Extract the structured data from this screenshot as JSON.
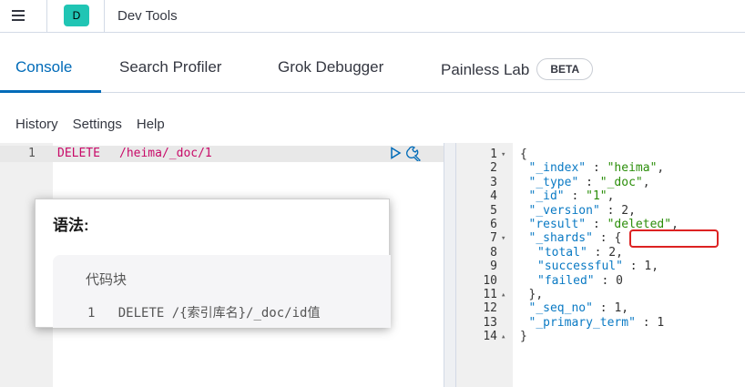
{
  "header": {
    "space_initial": "D",
    "app_title": "Dev Tools",
    "space_color": "#20c5b4"
  },
  "tabs": [
    {
      "label": "Console",
      "active": true
    },
    {
      "label": "Search Profiler",
      "active": false
    },
    {
      "label": "Grok Debugger",
      "active": false
    },
    {
      "label": "Painless Lab",
      "active": false,
      "badge": "BETA"
    }
  ],
  "subnav": {
    "history": "History",
    "settings": "Settings",
    "help": "Help"
  },
  "request": {
    "line_number": "1",
    "method": "DELETE",
    "path": "/heima/_doc/1"
  },
  "response": {
    "lines": [
      {
        "n": "1",
        "fold": "▾",
        "text": "{"
      },
      {
        "n": "2",
        "fold": "",
        "key": "\"_index\"",
        "sep": " : ",
        "val": "\"heima\"",
        "tail": ","
      },
      {
        "n": "3",
        "fold": "",
        "key": "\"_type\"",
        "sep": " : ",
        "val": "\"_doc\"",
        "tail": ","
      },
      {
        "n": "4",
        "fold": "",
        "key": "\"_id\"",
        "sep": " : ",
        "val": "\"1\"",
        "tail": ","
      },
      {
        "n": "5",
        "fold": "",
        "key": "\"_version\"",
        "sep": " : ",
        "val": "2",
        "tail": ","
      },
      {
        "n": "6",
        "fold": "",
        "key": "\"result\"",
        "sep": " : ",
        "val": "\"deleted\"",
        "tail": ","
      },
      {
        "n": "7",
        "fold": "▾",
        "key": "\"_shards\"",
        "sep": " : ",
        "val": "{",
        "tail": ""
      },
      {
        "n": "8",
        "fold": "",
        "key": "\"total\"",
        "sep": " : ",
        "val": "2",
        "tail": ","
      },
      {
        "n": "9",
        "fold": "",
        "key": "\"successful\"",
        "sep": " : ",
        "val": "1",
        "tail": ","
      },
      {
        "n": "10",
        "fold": "",
        "key": "\"failed\"",
        "sep": " : ",
        "val": "0",
        "tail": ""
      },
      {
        "n": "11",
        "fold": "▴",
        "text": "},"
      },
      {
        "n": "12",
        "fold": "",
        "key": "\"_seq_no\"",
        "sep": " : ",
        "val": "1",
        "tail": ","
      },
      {
        "n": "13",
        "fold": "",
        "key": "\"_primary_term\"",
        "sep": " : ",
        "val": "1",
        "tail": ""
      },
      {
        "n": "14",
        "fold": "▴",
        "text": "}"
      }
    ]
  },
  "note_card": {
    "title": "语法:",
    "code_label": "代码块",
    "code_line_number": "1",
    "code_text": "DELETE /{索引库名}/_doc/id值"
  }
}
